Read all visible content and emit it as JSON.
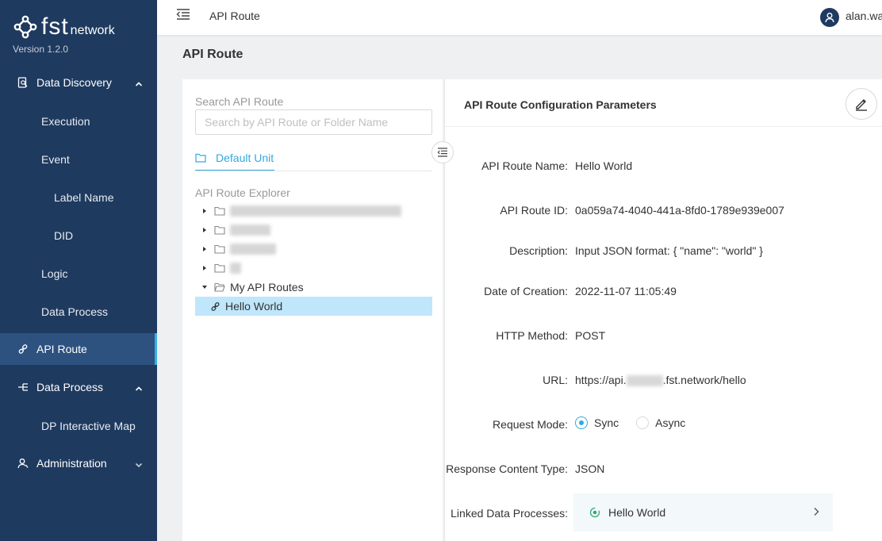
{
  "app": {
    "logo_text": "fst",
    "logo_sub": "network",
    "version": "Version 1.2.0"
  },
  "sidebar": {
    "items": [
      {
        "label": "Data Discovery",
        "icon": "data-discovery-icon"
      },
      {
        "label": "Execution"
      },
      {
        "label": "Event"
      },
      {
        "label": "Label Name"
      },
      {
        "label": "DID"
      },
      {
        "label": "Logic"
      },
      {
        "label": "Data Process"
      },
      {
        "label": "API Route",
        "icon": "api-link-icon",
        "active": true
      },
      {
        "label": "Data Process",
        "icon": "data-process-icon"
      },
      {
        "label": "DP Interactive Map"
      },
      {
        "label": "Administration",
        "icon": "admin-user-icon"
      }
    ]
  },
  "topbar": {
    "breadcrumb": "API Route",
    "username": "alan.wa"
  },
  "page": {
    "title": "API Route"
  },
  "explorer": {
    "search_label": "Search API Route",
    "search_placeholder": "Search by API Route or Folder Name",
    "search_value": "",
    "unit_tab": "Default Unit",
    "explorer_label": "API Route Explorer",
    "folders": [
      {
        "label": "",
        "redacted": true
      },
      {
        "label": "",
        "redacted": true
      },
      {
        "label": "",
        "redacted": true
      },
      {
        "label": "",
        "redacted": true
      },
      {
        "label": "My API Routes",
        "expanded": true
      }
    ],
    "routes": [
      {
        "label": "Hello World",
        "selected": true
      }
    ]
  },
  "config": {
    "header": "API Route Configuration Parameters",
    "fields": {
      "name_label": "API Route Name:",
      "name_value": "Hello World",
      "id_label": "API Route ID:",
      "id_value": "0a059a74-4040-441a-8fd0-1789e939e007",
      "desc_label": "Description:",
      "desc_value": "Input JSON format: { \"name\": \"world\" }",
      "date_label": "Date of Creation:",
      "date_value": "2022-11-07 11:05:49",
      "method_label": "HTTP Method:",
      "method_value": "POST",
      "url_label": "URL:",
      "url_prefix": "https://api.",
      "url_suffix": ".fst.network/hello",
      "mode_label": "Request Mode:",
      "mode_options": [
        "Sync",
        "Async"
      ],
      "mode_selected": "Sync",
      "content_type_label": "Response Content Type:",
      "content_type_value": "JSON",
      "linked_label": "Linked Data Processes:",
      "linked_value": "Hello World"
    }
  },
  "colors": {
    "sidebar_bg": "#1f3a5f",
    "accent": "#35a8df",
    "selected_row": "#bfe6fb"
  }
}
